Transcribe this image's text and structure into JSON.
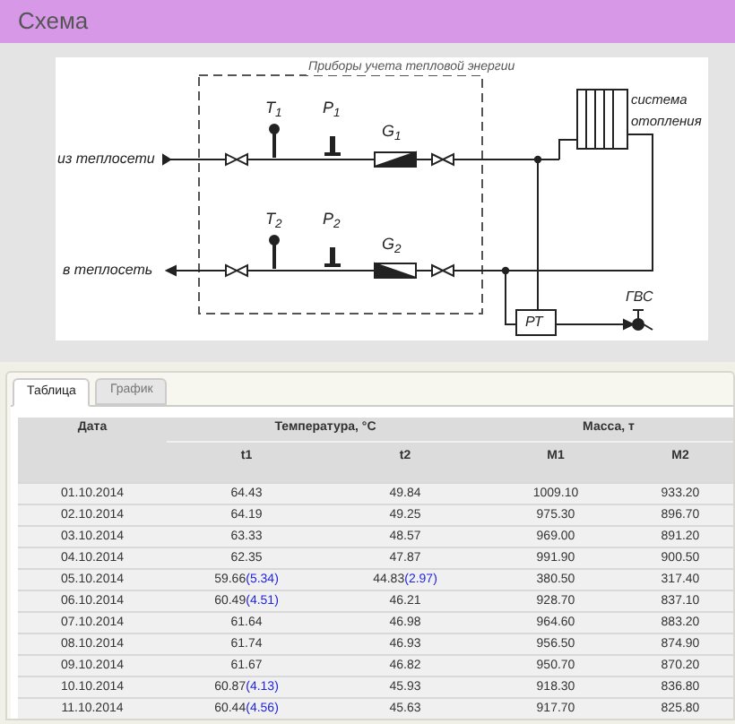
{
  "header": {
    "title": "Схема"
  },
  "scheme": {
    "caption": "Приборы учета тепловой энергии",
    "labels": [
      {
        "kind": "inlet",
        "text": "из теплосети"
      },
      {
        "kind": "outlet",
        "text": "в теплосеть"
      },
      {
        "kind": "t1",
        "text": "T$_{1}$"
      },
      {
        "kind": "p1",
        "text": "P$_{1}$"
      },
      {
        "kind": "g1",
        "text": "G$_{1}$"
      },
      {
        "kind": "t2",
        "text": "T$_{2}$"
      },
      {
        "kind": "p2",
        "text": "P$_{2}$"
      },
      {
        "kind": "g2",
        "text": "G$_{2}$"
      },
      {
        "kind": "heating",
        "text": "система отопления"
      },
      {
        "kind": "hotwater",
        "text": "ГВС"
      },
      {
        "kind": "regulator",
        "text": "РТ"
      }
    ]
  },
  "tabs": [
    {
      "label": "Таблица",
      "selected": true
    },
    {
      "label": "График",
      "selected": false
    }
  ],
  "table": {
    "groups": [
      {
        "label": "Дата"
      },
      {
        "label": "Температура, °C",
        "columns": [
          "t1",
          "t2"
        ]
      },
      {
        "label": "Масса, т",
        "columns": [
          "M1",
          "M2"
        ]
      }
    ],
    "rows": [
      {
        "date": "01.10.2014",
        "t1": {
          "value": "64.43"
        },
        "t2": {
          "value": "49.84"
        },
        "m1": "1009.10",
        "m2": "933.20"
      },
      {
        "date": "02.10.2014",
        "t1": {
          "value": "64.19"
        },
        "t2": {
          "value": "49.25"
        },
        "m1": "975.30",
        "m2": "896.70"
      },
      {
        "date": "03.10.2014",
        "t1": {
          "value": "63.33"
        },
        "t2": {
          "value": "48.57"
        },
        "m1": "969.00",
        "m2": "891.20"
      },
      {
        "date": "04.10.2014",
        "t1": {
          "value": "62.35"
        },
        "t2": {
          "value": "47.87"
        },
        "m1": "991.90",
        "m2": "900.50"
      },
      {
        "date": "05.10.2014",
        "t1": {
          "value": "59.66",
          "note": "(5.34)"
        },
        "t2": {
          "value": "44.83",
          "note": "(2.97)"
        },
        "m1": "380.50",
        "m2": "317.40"
      },
      {
        "date": "06.10.2014",
        "t1": {
          "value": "60.49",
          "note": "(4.51)"
        },
        "t2": {
          "value": "46.21"
        },
        "m1": "928.70",
        "m2": "837.10"
      },
      {
        "date": "07.10.2014",
        "t1": {
          "value": "61.64"
        },
        "t2": {
          "value": "46.98"
        },
        "m1": "964.60",
        "m2": "883.20"
      },
      {
        "date": "08.10.2014",
        "t1": {
          "value": "61.74"
        },
        "t2": {
          "value": "46.93"
        },
        "m1": "956.50",
        "m2": "874.90"
      },
      {
        "date": "09.10.2014",
        "t1": {
          "value": "61.67"
        },
        "t2": {
          "value": "46.82"
        },
        "m1": "950.70",
        "m2": "870.20"
      },
      {
        "date": "10.10.2014",
        "t1": {
          "value": "60.87",
          "note": "(4.13)"
        },
        "t2": {
          "value": "45.93"
        },
        "m1": "918.30",
        "m2": "836.80"
      },
      {
        "date": "11.10.2014",
        "t1": {
          "value": "60.44",
          "note": "(4.56)"
        },
        "t2": {
          "value": "45.63"
        },
        "m1": "917.70",
        "m2": "825.80"
      }
    ]
  }
}
